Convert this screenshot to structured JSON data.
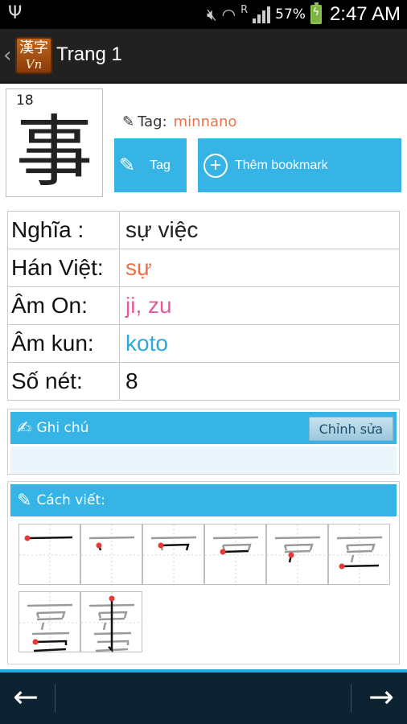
{
  "status_bar": {
    "battery_percent": "57%",
    "signal_letter": "R",
    "time": "2:47 AM"
  },
  "action_bar": {
    "logo_top": "漢字",
    "logo_bottom": "Vn",
    "title": "Trang 1"
  },
  "kanji": {
    "character": "事",
    "stroke_count_badge": "18"
  },
  "tag": {
    "label": "Tag:",
    "value": "minnano"
  },
  "buttons": {
    "tag_label": "Tag",
    "bookmark_label": "Thêm bookmark"
  },
  "info": [
    {
      "key": "Nghĩa :",
      "value": "sự việc",
      "color": "#222222"
    },
    {
      "key": "Hán Việt:",
      "value": "sự",
      "color": "#e8744b"
    },
    {
      "key": "Âm On:",
      "value": "ji, zu",
      "color": "#e45a9a"
    },
    {
      "key": "Âm kun:",
      "value": "koto",
      "color": "#2ea8dc"
    },
    {
      "key": "Số nét:",
      "value": "8",
      "color": "#111111"
    }
  ],
  "note": {
    "title": "Ghi chú",
    "edit_label": "Chỉnh sửa"
  },
  "writing": {
    "title": "Cách viết:",
    "steps": [
      1,
      2,
      3,
      4,
      5,
      6,
      7,
      8
    ]
  },
  "colors": {
    "accent": "#35b4e5",
    "stroke_start": "#e53935"
  }
}
